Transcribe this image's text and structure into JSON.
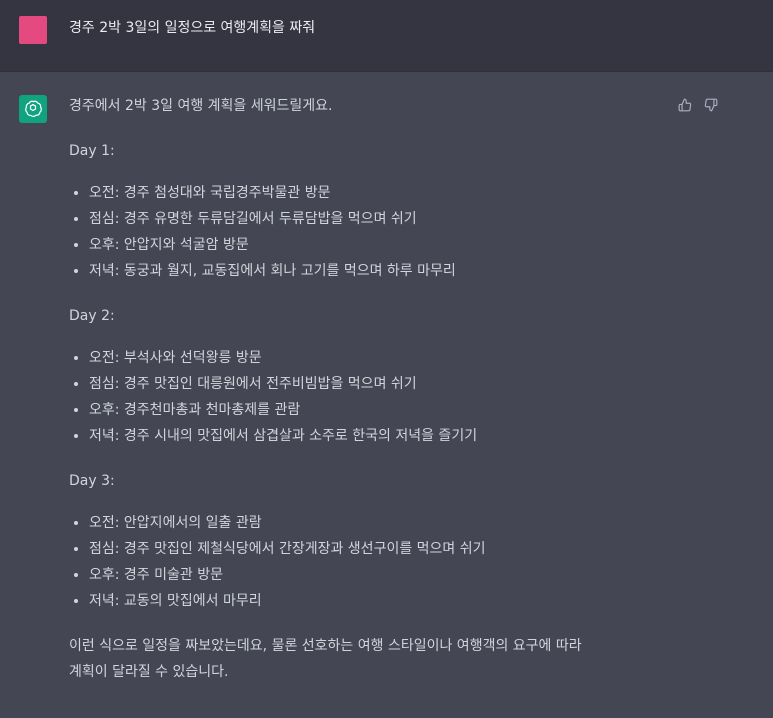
{
  "user": {
    "avatar_color": "#e4497f",
    "message": "경주 2박 3일의 일정으로 여행계획을 짜줘"
  },
  "assistant": {
    "avatar_color": "#10a37f",
    "avatar_icon": "openai-logo-icon",
    "intro": "경주에서 2박 3일 여행 계획을 세워드릴게요.",
    "days": [
      {
        "heading": "Day 1:",
        "items": [
          "오전: 경주 첨성대와 국립경주박물관 방문",
          "점심: 경주 유명한 두류담길에서 두류담밥을 먹으며 쉬기",
          "오후: 안압지와 석굴암 방문",
          "저녁: 동궁과 월지, 교동집에서 회나 고기를 먹으며 하루 마무리"
        ]
      },
      {
        "heading": "Day 2:",
        "items": [
          "오전: 부석사와 선덕왕릉 방문",
          "점심: 경주 맛집인 대릉원에서 전주비빔밥을 먹으며 쉬기",
          "오후: 경주천마총과 천마총제를 관람",
          "저녁: 경주 시내의 맛집에서 삼겹살과 소주로 한국의 저녁을 즐기기"
        ]
      },
      {
        "heading": "Day 3:",
        "items": [
          "오전: 안압지에서의 일출 관람",
          "점심: 경주 맛집인 제철식당에서 간장게장과 생선구이를 먹으며 쉬기",
          "오후: 경주 미술관 방문",
          "저녁: 교동의 맛집에서 마무리"
        ]
      }
    ],
    "outro_line1": "이런 식으로 일정을 짜보았는데요, 물론 선호하는 여행 스타일이나 여행객의 요구에 따라",
    "outro_line2": "계획이 달라질 수 있습니다."
  },
  "feedback": {
    "thumbs_up_icon": "thumbs-up-icon",
    "thumbs_down_icon": "thumbs-down-icon"
  }
}
